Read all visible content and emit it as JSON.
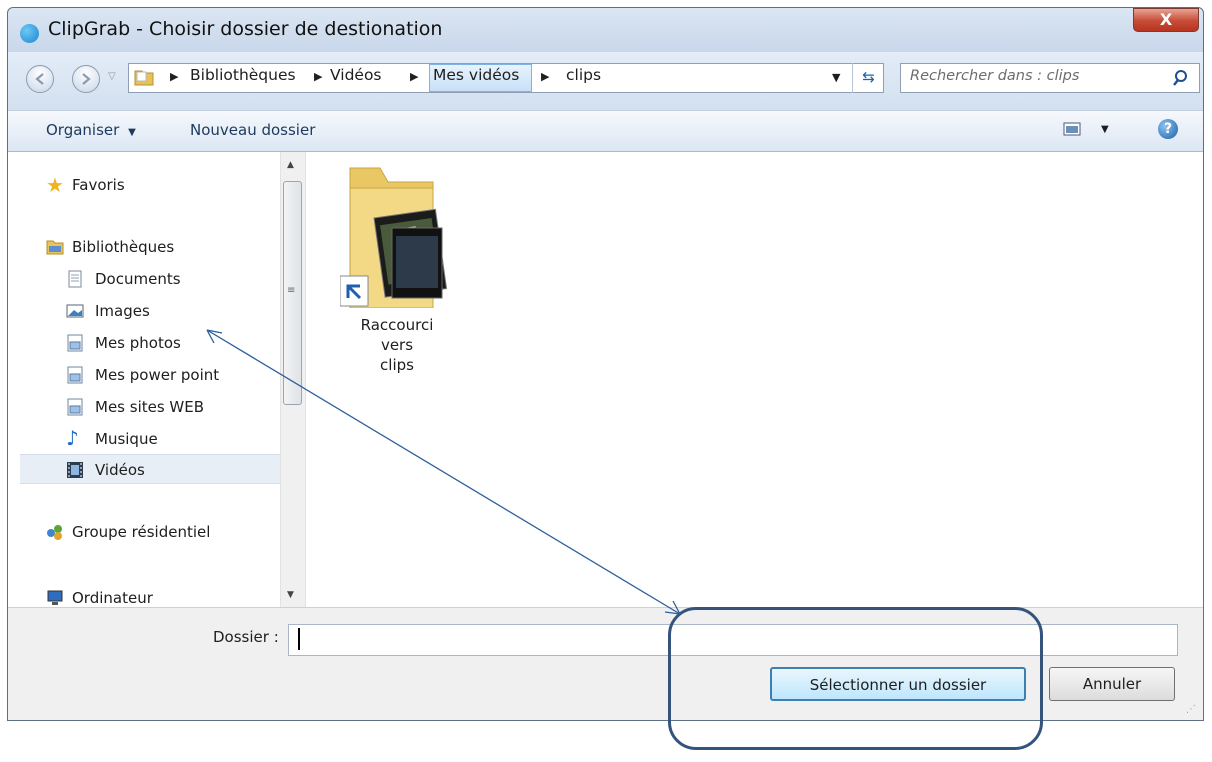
{
  "window": {
    "title": "ClipGrab - Choisir dossier de destionation",
    "close_label": "X"
  },
  "address": {
    "crumbs": [
      "Bibliothèques",
      "Vidéos",
      "Mes vidéos",
      "clips"
    ],
    "search_placeholder": "Rechercher dans : clips"
  },
  "toolbar": {
    "organize": "Organiser",
    "new_folder": "Nouveau dossier",
    "help": "?"
  },
  "nav": {
    "favorites": "Favoris",
    "libraries": "Bibliothèques",
    "items": [
      "Documents",
      "Images",
      "Mes photos",
      "Mes power point",
      "Mes sites WEB",
      "Musique",
      "Vidéos"
    ],
    "homegroup": "Groupe résidentiel",
    "computer": "Ordinateur",
    "selected": "Vidéos"
  },
  "content": {
    "items": [
      {
        "label_line1": "Raccourci vers",
        "label_line2": "clips",
        "type": "folder-shortcut"
      }
    ]
  },
  "bottom": {
    "folder_label": "Dossier :",
    "folder_value": "",
    "select_button": "Sélectionner un dossier",
    "cancel_button": "Annuler"
  },
  "colors": {
    "accent": "#3c7fb1",
    "annotation": "#34547e",
    "arrow": "#2d5f9c"
  }
}
